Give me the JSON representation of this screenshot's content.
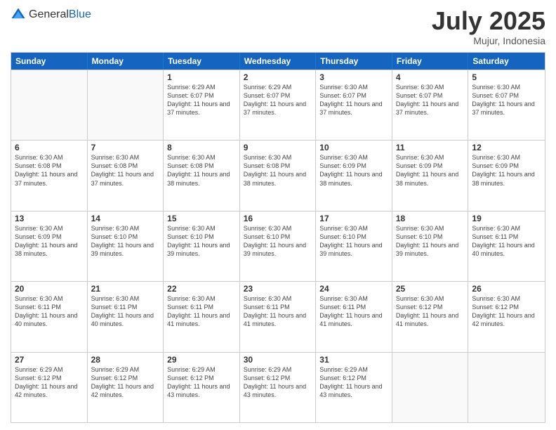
{
  "header": {
    "logo_general": "General",
    "logo_blue": "Blue",
    "month": "July 2025",
    "location": "Mujur, Indonesia"
  },
  "days_of_week": [
    "Sunday",
    "Monday",
    "Tuesday",
    "Wednesday",
    "Thursday",
    "Friday",
    "Saturday"
  ],
  "weeks": [
    [
      {
        "day": "",
        "empty": true
      },
      {
        "day": "",
        "empty": true
      },
      {
        "day": "1",
        "sunrise": "Sunrise: 6:29 AM",
        "sunset": "Sunset: 6:07 PM",
        "daylight": "Daylight: 11 hours and 37 minutes."
      },
      {
        "day": "2",
        "sunrise": "Sunrise: 6:29 AM",
        "sunset": "Sunset: 6:07 PM",
        "daylight": "Daylight: 11 hours and 37 minutes."
      },
      {
        "day": "3",
        "sunrise": "Sunrise: 6:30 AM",
        "sunset": "Sunset: 6:07 PM",
        "daylight": "Daylight: 11 hours and 37 minutes."
      },
      {
        "day": "4",
        "sunrise": "Sunrise: 6:30 AM",
        "sunset": "Sunset: 6:07 PM",
        "daylight": "Daylight: 11 hours and 37 minutes."
      },
      {
        "day": "5",
        "sunrise": "Sunrise: 6:30 AM",
        "sunset": "Sunset: 6:07 PM",
        "daylight": "Daylight: 11 hours and 37 minutes."
      }
    ],
    [
      {
        "day": "6",
        "sunrise": "Sunrise: 6:30 AM",
        "sunset": "Sunset: 6:08 PM",
        "daylight": "Daylight: 11 hours and 37 minutes."
      },
      {
        "day": "7",
        "sunrise": "Sunrise: 6:30 AM",
        "sunset": "Sunset: 6:08 PM",
        "daylight": "Daylight: 11 hours and 37 minutes."
      },
      {
        "day": "8",
        "sunrise": "Sunrise: 6:30 AM",
        "sunset": "Sunset: 6:08 PM",
        "daylight": "Daylight: 11 hours and 38 minutes."
      },
      {
        "day": "9",
        "sunrise": "Sunrise: 6:30 AM",
        "sunset": "Sunset: 6:08 PM",
        "daylight": "Daylight: 11 hours and 38 minutes."
      },
      {
        "day": "10",
        "sunrise": "Sunrise: 6:30 AM",
        "sunset": "Sunset: 6:09 PM",
        "daylight": "Daylight: 11 hours and 38 minutes."
      },
      {
        "day": "11",
        "sunrise": "Sunrise: 6:30 AM",
        "sunset": "Sunset: 6:09 PM",
        "daylight": "Daylight: 11 hours and 38 minutes."
      },
      {
        "day": "12",
        "sunrise": "Sunrise: 6:30 AM",
        "sunset": "Sunset: 6:09 PM",
        "daylight": "Daylight: 11 hours and 38 minutes."
      }
    ],
    [
      {
        "day": "13",
        "sunrise": "Sunrise: 6:30 AM",
        "sunset": "Sunset: 6:09 PM",
        "daylight": "Daylight: 11 hours and 38 minutes."
      },
      {
        "day": "14",
        "sunrise": "Sunrise: 6:30 AM",
        "sunset": "Sunset: 6:10 PM",
        "daylight": "Daylight: 11 hours and 39 minutes."
      },
      {
        "day": "15",
        "sunrise": "Sunrise: 6:30 AM",
        "sunset": "Sunset: 6:10 PM",
        "daylight": "Daylight: 11 hours and 39 minutes."
      },
      {
        "day": "16",
        "sunrise": "Sunrise: 6:30 AM",
        "sunset": "Sunset: 6:10 PM",
        "daylight": "Daylight: 11 hours and 39 minutes."
      },
      {
        "day": "17",
        "sunrise": "Sunrise: 6:30 AM",
        "sunset": "Sunset: 6:10 PM",
        "daylight": "Daylight: 11 hours and 39 minutes."
      },
      {
        "day": "18",
        "sunrise": "Sunrise: 6:30 AM",
        "sunset": "Sunset: 6:10 PM",
        "daylight": "Daylight: 11 hours and 39 minutes."
      },
      {
        "day": "19",
        "sunrise": "Sunrise: 6:30 AM",
        "sunset": "Sunset: 6:11 PM",
        "daylight": "Daylight: 11 hours and 40 minutes."
      }
    ],
    [
      {
        "day": "20",
        "sunrise": "Sunrise: 6:30 AM",
        "sunset": "Sunset: 6:11 PM",
        "daylight": "Daylight: 11 hours and 40 minutes."
      },
      {
        "day": "21",
        "sunrise": "Sunrise: 6:30 AM",
        "sunset": "Sunset: 6:11 PM",
        "daylight": "Daylight: 11 hours and 40 minutes."
      },
      {
        "day": "22",
        "sunrise": "Sunrise: 6:30 AM",
        "sunset": "Sunset: 6:11 PM",
        "daylight": "Daylight: 11 hours and 41 minutes."
      },
      {
        "day": "23",
        "sunrise": "Sunrise: 6:30 AM",
        "sunset": "Sunset: 6:11 PM",
        "daylight": "Daylight: 11 hours and 41 minutes."
      },
      {
        "day": "24",
        "sunrise": "Sunrise: 6:30 AM",
        "sunset": "Sunset: 6:11 PM",
        "daylight": "Daylight: 11 hours and 41 minutes."
      },
      {
        "day": "25",
        "sunrise": "Sunrise: 6:30 AM",
        "sunset": "Sunset: 6:12 PM",
        "daylight": "Daylight: 11 hours and 41 minutes."
      },
      {
        "day": "26",
        "sunrise": "Sunrise: 6:30 AM",
        "sunset": "Sunset: 6:12 PM",
        "daylight": "Daylight: 11 hours and 42 minutes."
      }
    ],
    [
      {
        "day": "27",
        "sunrise": "Sunrise: 6:29 AM",
        "sunset": "Sunset: 6:12 PM",
        "daylight": "Daylight: 11 hours and 42 minutes."
      },
      {
        "day": "28",
        "sunrise": "Sunrise: 6:29 AM",
        "sunset": "Sunset: 6:12 PM",
        "daylight": "Daylight: 11 hours and 42 minutes."
      },
      {
        "day": "29",
        "sunrise": "Sunrise: 6:29 AM",
        "sunset": "Sunset: 6:12 PM",
        "daylight": "Daylight: 11 hours and 43 minutes."
      },
      {
        "day": "30",
        "sunrise": "Sunrise: 6:29 AM",
        "sunset": "Sunset: 6:12 PM",
        "daylight": "Daylight: 11 hours and 43 minutes."
      },
      {
        "day": "31",
        "sunrise": "Sunrise: 6:29 AM",
        "sunset": "Sunset: 6:12 PM",
        "daylight": "Daylight: 11 hours and 43 minutes."
      },
      {
        "day": "",
        "empty": true
      },
      {
        "day": "",
        "empty": true
      }
    ]
  ]
}
